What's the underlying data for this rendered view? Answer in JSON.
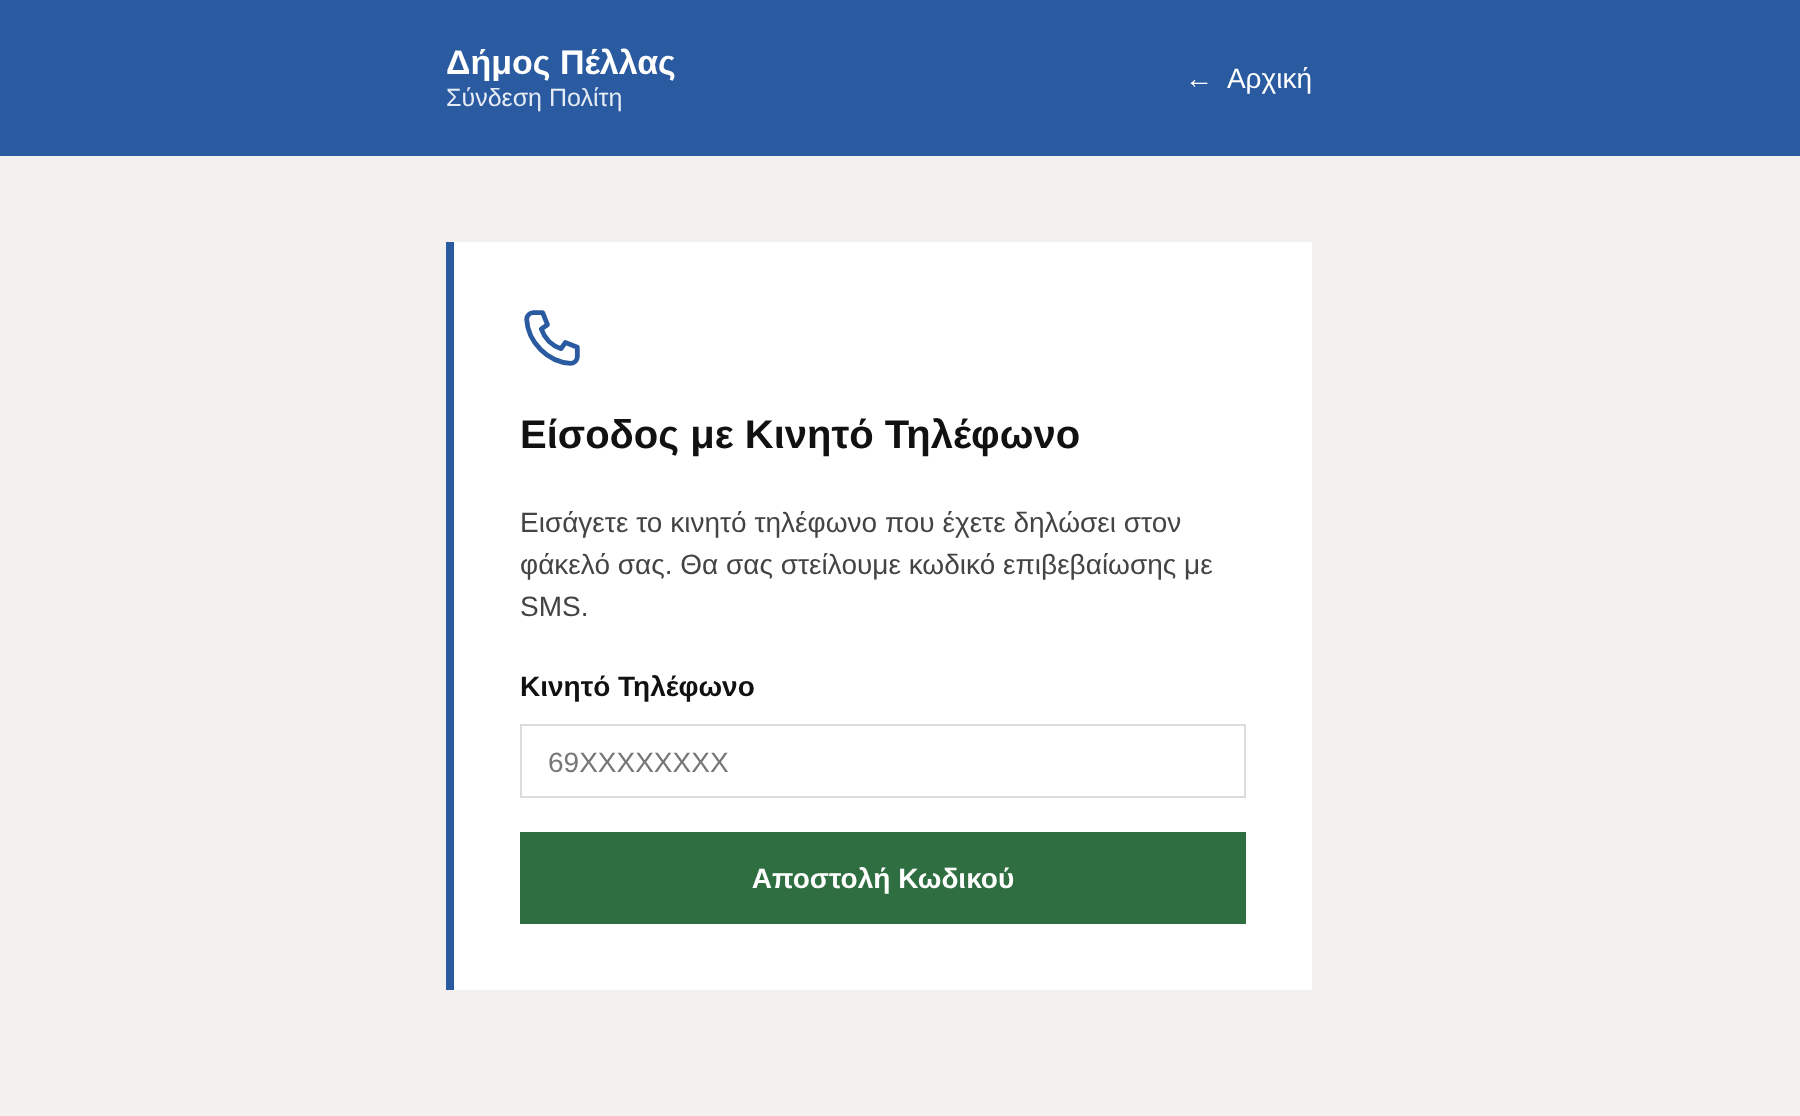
{
  "header": {
    "title": "Δήμος Πέλλας",
    "subtitle": "Σύνδεση Πολίτη",
    "back_link": {
      "arrow": "←",
      "label": "Αρχική"
    }
  },
  "card": {
    "heading": "Είσοδος με Κινητό Τηλέφωνο",
    "description": "Εισάγετε το κινητό τηλέφωνο που έχετε δηλώσει στον φάκελό σας. Θα σας στείλουμε κωδικό επιβεβαίωσης με SMS.",
    "field": {
      "label": "Κινητό Τηλέφωνο",
      "placeholder": "69XXXXXXXX"
    },
    "button": "Αποστολή Κωδικού"
  }
}
